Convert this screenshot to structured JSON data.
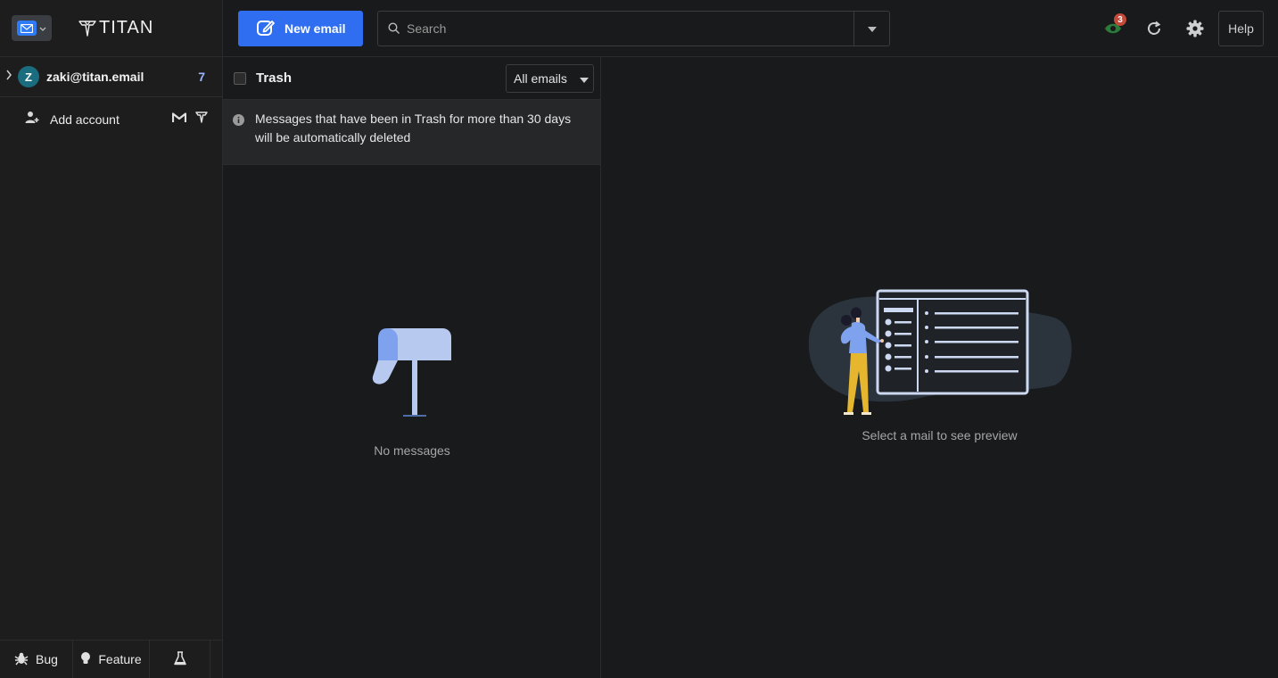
{
  "brand": {
    "logo_text": "TITAN"
  },
  "account": {
    "avatar_letter": "Z",
    "email": "zaki@titan.email",
    "unread_count": "7"
  },
  "sidebar": {
    "add_account_label": "Add account",
    "bottom": {
      "bug_label": "Bug",
      "feature_label": "Feature"
    }
  },
  "toolbar": {
    "new_email_label": "New email",
    "search_placeholder": "Search",
    "notification_count": "3",
    "help_label": "Help"
  },
  "list": {
    "folder_title": "Trash",
    "filter_value": "All emails",
    "info_message": "Messages that have been in Trash for more than 30 days will be automatically deleted",
    "empty_label": "No messages"
  },
  "preview": {
    "empty_label": "Select a mail to see preview"
  },
  "colors": {
    "accent": "#2f6ef0",
    "background": "#181a1b",
    "sidebar": "#1d1d1d",
    "avatar": "#1a6d7e",
    "badge": "#c24a3a",
    "unread": "#9cb4ff"
  }
}
